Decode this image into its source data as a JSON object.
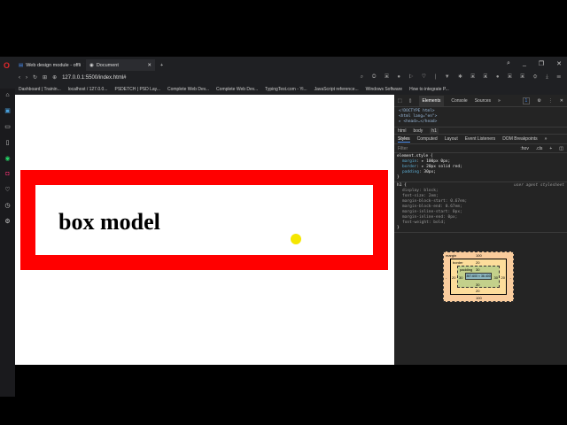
{
  "tabs": [
    {
      "label": "Web design module - offli"
    },
    {
      "label": "Document"
    }
  ],
  "address": "127.0.0.1:5500/index.html#",
  "bookmarks": [
    "Dashboard | Trainin...",
    "localhost / 127.0.0...",
    "PSDETCH | PSD Lay...",
    "Complete Web Dev...",
    "Complete Web Dev...",
    "TypingTest.com - Yi...",
    "JavaScript reference...",
    "Windows Software",
    "How to integrate P..."
  ],
  "page": {
    "heading": "box model"
  },
  "devtools": {
    "tabs": [
      "Elements",
      "Console",
      "Sources",
      "»"
    ],
    "badge": "1",
    "dom": [
      "<!DOCTYPE html>",
      "<html lang=\"en\">",
      "▸ <head>…</head>"
    ],
    "breadcrumb": [
      "html",
      "body",
      "h1"
    ],
    "subtabs": [
      "Styles",
      "Computed",
      "Layout",
      "Event Listeners",
      "DOM Breakpoints",
      "»"
    ],
    "filter_placeholder": "Filter",
    "hov": ":hov",
    ".cls": ".cls",
    "element_style": {
      "selector": "element.style {",
      "rules": [
        [
          "margin",
          "▸ 100px 0px;"
        ],
        [
          "border",
          "▸ 20px solid red;"
        ],
        [
          "padding",
          "30px;"
        ]
      ]
    },
    "h1_style": {
      "selector": "h1 {",
      "source": "user agent stylesheet",
      "rules": [
        [
          "display",
          "block;"
        ],
        [
          "font-size",
          "2em;"
        ],
        [
          "margin-block-start",
          "0.67em;"
        ],
        [
          "margin-block-end",
          "0.67em;"
        ],
        [
          "margin-inline-start",
          "0px;"
        ],
        [
          "margin-inline-end",
          "0px;"
        ],
        [
          "font-weight",
          "bold;"
        ]
      ]
    },
    "close_brace": "}",
    "boxmodel": {
      "margin_label": "margin",
      "margin_top": "100",
      "margin_bottom": "100",
      "margin_side": "-",
      "border_label": "border",
      "border": "20",
      "padding_label": "padding",
      "padding": "30",
      "content": "357.600 × 36.400"
    }
  }
}
